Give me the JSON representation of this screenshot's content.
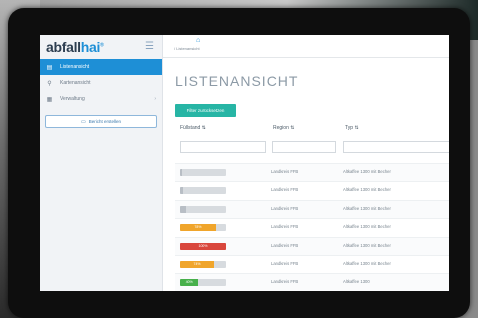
{
  "app": {
    "logo_main": "abfall",
    "logo_accent": "hai",
    "logo_mark": "®",
    "menu_icon": "hamburger-icon"
  },
  "sidebar": {
    "items": [
      {
        "label": "Listenansicht",
        "icon": "list-icon",
        "active": true
      },
      {
        "label": "Kartenansicht",
        "icon": "map-pin-icon",
        "active": false
      },
      {
        "label": "Verwaltung",
        "icon": "grid-icon",
        "active": false,
        "expandable": true
      }
    ],
    "export_label": "Bericht erstellen"
  },
  "topbar": {
    "breadcrumb": "/ Listenansicht",
    "home_icon": "home-icon"
  },
  "page": {
    "title": "LISTENANSICHT",
    "filter_button": "Filter zurücksetzen"
  },
  "table": {
    "columns": [
      {
        "label": "Füllstand ⇅"
      },
      {
        "label": "Region ⇅"
      },
      {
        "label": "Typ ⇅"
      }
    ],
    "rows": [
      {
        "fill_percent": 4,
        "fill_label": "",
        "fill_color": "#b8bec5",
        "region": "Landkreis FFB",
        "type": "Altkaffee 1300 mit Becher"
      },
      {
        "fill_percent": 6,
        "fill_label": "",
        "fill_color": "#b8bec5",
        "region": "Landkreis FFB",
        "type": "Altkaffee 1300 mit Becher"
      },
      {
        "fill_percent": 14,
        "fill_label": "",
        "fill_color": "#b8bec5",
        "region": "Landkreis FFB",
        "type": "Altkaffee 1300 mit Becher"
      },
      {
        "fill_percent": 78,
        "fill_label": "78%",
        "fill_color": "#f0a52b",
        "region": "Landkreis FFB",
        "type": "Altkaffee 1300 mit Becher"
      },
      {
        "fill_percent": 100,
        "fill_label": "100%",
        "fill_color": "#d9473d",
        "region": "Landkreis FFB",
        "type": "Altkaffee 1300 mit Becher"
      },
      {
        "fill_percent": 74,
        "fill_label": "74%",
        "fill_color": "#f0a52b",
        "region": "Landkreis FFB",
        "type": "Altkaffee 1300 mit Becher"
      },
      {
        "fill_percent": 40,
        "fill_label": "40%",
        "fill_color": "#47b04b",
        "region": "Landkreis FFB",
        "type": "Altkaffee 1300"
      }
    ]
  },
  "colors": {
    "accent": "#1e8fd6",
    "teal": "#27b5a5"
  }
}
